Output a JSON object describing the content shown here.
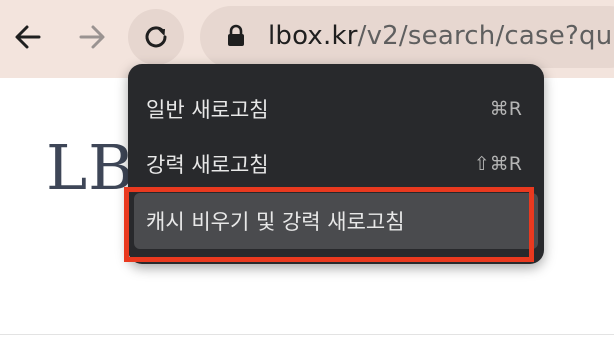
{
  "toolbar": {
    "back_icon": "arrow-left-icon",
    "forward_icon": "arrow-right-icon",
    "reload_icon": "reload-icon",
    "lock_icon": "lock-icon",
    "url_host": "lbox.kr",
    "url_path": "/v2/search/case?qu"
  },
  "page": {
    "logo_text": "LB"
  },
  "context_menu": {
    "items": [
      {
        "label": "일반 새로고침",
        "shortcut": "⌘R"
      },
      {
        "label": "강력 새로고침",
        "shortcut": "⇧⌘R"
      },
      {
        "label": "캐시 비우기 및 강력 새로고침",
        "shortcut": ""
      }
    ]
  },
  "colors": {
    "toolbar_bg": "#f3e4dd",
    "menu_bg": "#28292c",
    "menu_hover": "#4a4b4e",
    "highlight": "#e9391f",
    "logo": "#3e4657"
  }
}
